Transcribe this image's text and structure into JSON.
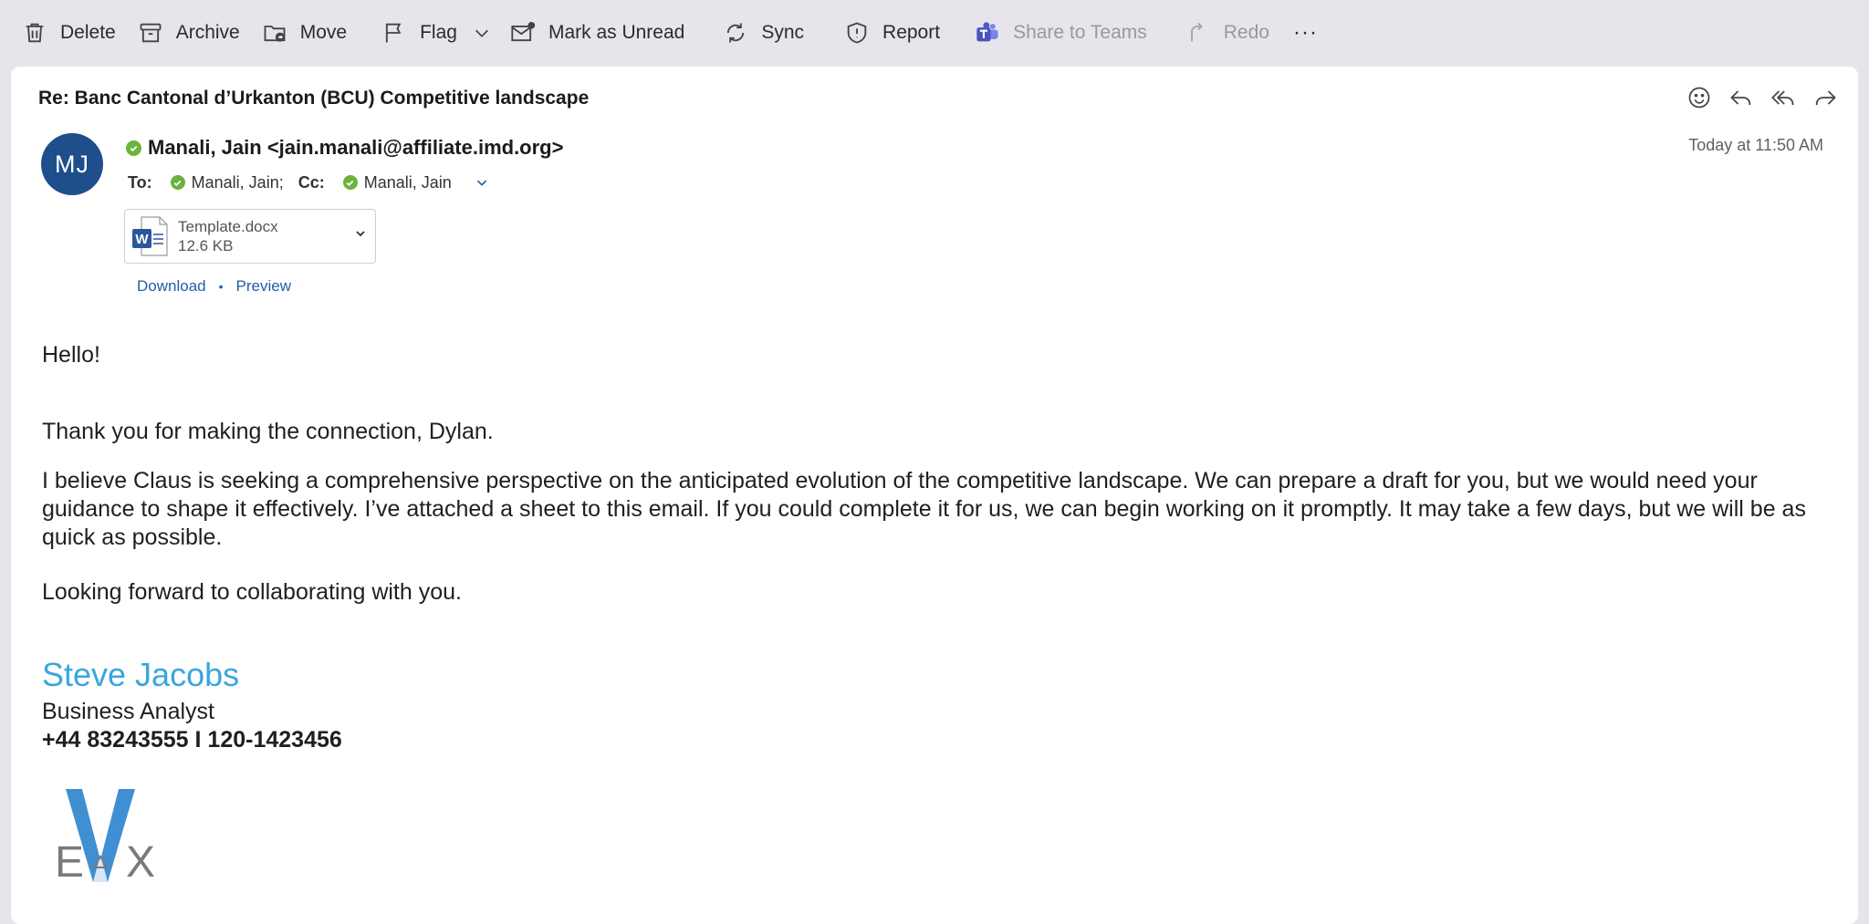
{
  "toolbar": {
    "delete": "Delete",
    "archive": "Archive",
    "move": "Move",
    "flag": "Flag",
    "mark_unread": "Mark as Unread",
    "sync": "Sync",
    "report": "Report",
    "share_teams": "Share to Teams",
    "redo": "Redo",
    "more": "···"
  },
  "message": {
    "subject": "Re: Banc Cantonal d’Urkanton (BCU) Competitive landscape",
    "avatar_initials": "MJ",
    "from": "Manali, Jain <jain.manali@affiliate.imd.org>",
    "timestamp": "Today at 11:50 AM",
    "to_label": "To:",
    "to": "Manali, Jain;",
    "cc_label": "Cc:",
    "cc": "Manali, Jain"
  },
  "attachment": {
    "name": "Template.docx",
    "size": "12.6 KB",
    "download": "Download",
    "preview": "Preview",
    "separator": "•"
  },
  "body": {
    "greeting": "Hello!",
    "p1": "Thank you for making the connection, Dylan.",
    "p2": "I believe Claus is seeking a comprehensive perspective on the anticipated evolution of the competitive landscape. We can prepare a draft for you, but we would need your guidance to shape it effectively. I’ve attached a sheet to this email. If you could complete it for us, we can begin working on it promptly. It may take a few days, but we will be as quick as possible.",
    "p3": "Looking forward to collaborating with you."
  },
  "signature": {
    "name": "Steve Jacobs",
    "title": "Business Analyst",
    "phone": "+44 83243555 I 120-1423456",
    "logo_text": "EVX"
  },
  "colors": {
    "toolbar_bg": "#e8e4eb",
    "avatar_bg": "#1f4e8c",
    "presence": "#6bb33a",
    "link": "#1f5fa8",
    "signature_name": "#3aa6dd"
  }
}
